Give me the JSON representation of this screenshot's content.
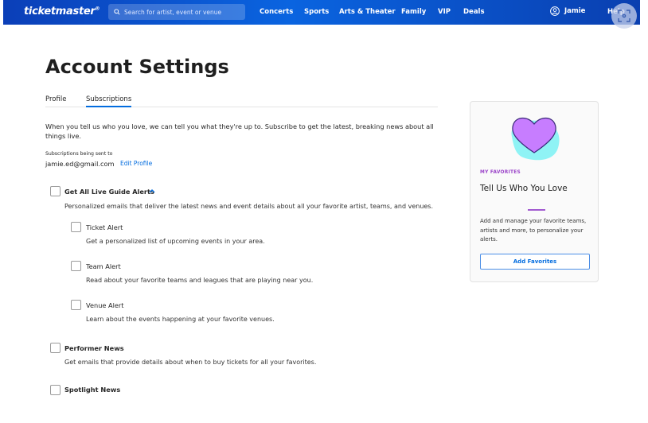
{
  "nav": {
    "logo": "ticketmaster",
    "search_placeholder": "Search for artist, event or venue",
    "links": [
      "Concerts",
      "Sports",
      "Arts & Theater",
      "Family",
      "VIP",
      "Deals"
    ],
    "user": "Jamie",
    "help": "Help"
  },
  "page": {
    "title": "Account Settings",
    "tabs": [
      {
        "label": "Profile",
        "active": false
      },
      {
        "label": "Subscriptions",
        "active": true
      }
    ],
    "intro": "When you tell us who you love, we can tell you what they're up to. Subscribe to get the latest, breaking news about all things live.",
    "sent_label": "Subscriptions being sent to",
    "email": "jamie.ed@gmail.com",
    "edit_profile": "Edit Profile",
    "alerts": {
      "label": "Get All Live Guide Alerts",
      "desc": "Personalized emails that deliver the latest news and event details about all your favorite artist, teams, and venues.",
      "checked": false
    },
    "sub_alerts": [
      {
        "label": "Ticket Alert",
        "desc": "Get a personalized list of upcoming events in your area.",
        "checked": false
      },
      {
        "label": "Team Alert",
        "desc": "Read about your favorite teams and leagues that are playing near you.",
        "checked": false
      },
      {
        "label": "Venue Alert",
        "desc": "Learn about the events happening at your favorite venues.",
        "checked": false
      }
    ],
    "performer": {
      "label": "Performer News",
      "desc": "Get emails that provide details about when to buy tickets for all your favorites.",
      "checked": false
    },
    "spotlight": {
      "label": "Spotlight News",
      "checked": false
    }
  },
  "card": {
    "kicker": "MY FAVORITES",
    "title": "Tell Us Who You Love",
    "text": "Add and manage your favorite teams, artists and more, to personalize your alerts.",
    "button": "Add Favorites"
  },
  "colors": {
    "brand": "#026cdf",
    "accent": "#9b44c9"
  }
}
